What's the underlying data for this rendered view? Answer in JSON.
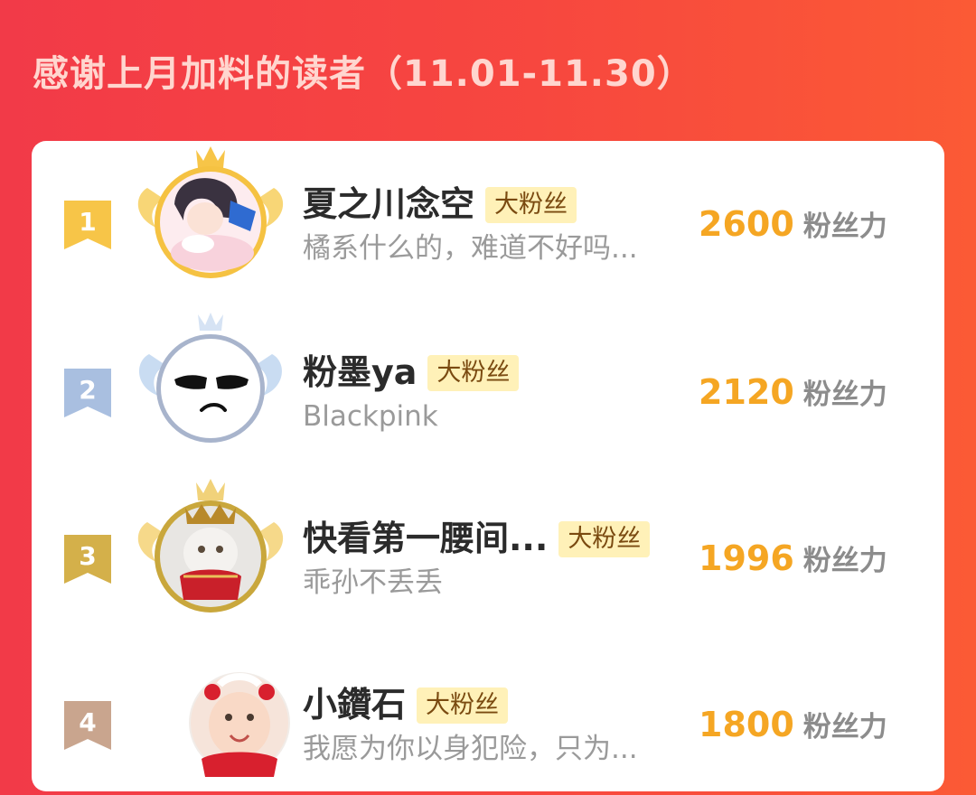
{
  "header": {
    "title": "感谢上月加料的读者（11.01-11.30）"
  },
  "badge_label": "大粉丝",
  "score_unit": "粉丝力",
  "colors": {
    "background": "#f7473f",
    "rank1": "#f7c548",
    "rank2": "#a9bfe0",
    "rank3": "#d4b04a",
    "rank4": "#c9a58e",
    "score": "#f5a623",
    "badge_bg": "#fff1b8"
  },
  "readers": [
    {
      "rank": "1",
      "name": "夏之川念空",
      "badge": "大粉丝",
      "description": "橘系什么的，难道不好吗...",
      "score": "2600",
      "unit": "粉丝力",
      "avatar_icon": "anime-girl-avatar",
      "frame_icon": "gold-crown-wings-frame"
    },
    {
      "rank": "2",
      "name": "粉墨ya",
      "badge": "大粉丝",
      "description": "Blackpink",
      "score": "2120",
      "unit": "粉丝力",
      "avatar_icon": "unamused-face-avatar",
      "frame_icon": "silver-crown-wings-frame"
    },
    {
      "rank": "3",
      "name": "快看第一腰间...",
      "badge": "大粉丝",
      "description": "乖孙不丢丢",
      "score": "1996",
      "unit": "粉丝力",
      "avatar_icon": "crowned-cat-avatar",
      "frame_icon": "bronze-crown-wings-frame"
    },
    {
      "rank": "4",
      "name": "小鑽石",
      "badge": "大粉丝",
      "description": "我愿为你以身犯险，只为...",
      "score": "1800",
      "unit": "粉丝力",
      "avatar_icon": "baby-avatar",
      "frame_icon": ""
    }
  ]
}
